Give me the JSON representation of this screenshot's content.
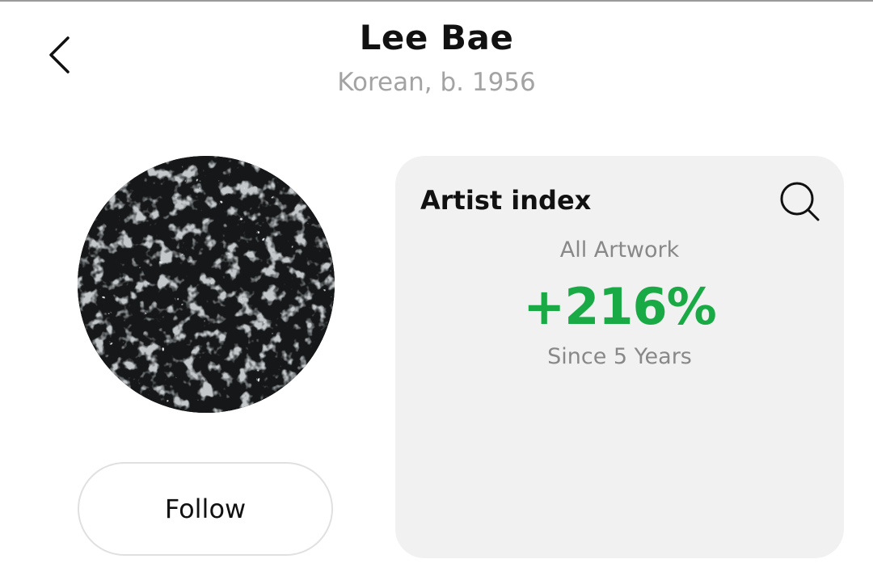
{
  "header": {
    "title": "Lee Bae",
    "subtitle": "Korean, b. 1956",
    "back_icon": "chevron-left-icon"
  },
  "profile": {
    "follow_label": "Follow"
  },
  "index_card": {
    "title": "Artist index",
    "search_icon": "search-icon",
    "label": "All Artwork",
    "value": "+216%",
    "period": "Since 5 Years",
    "value_color": "#1aaa45",
    "card_bg": "#f1f1f1"
  }
}
